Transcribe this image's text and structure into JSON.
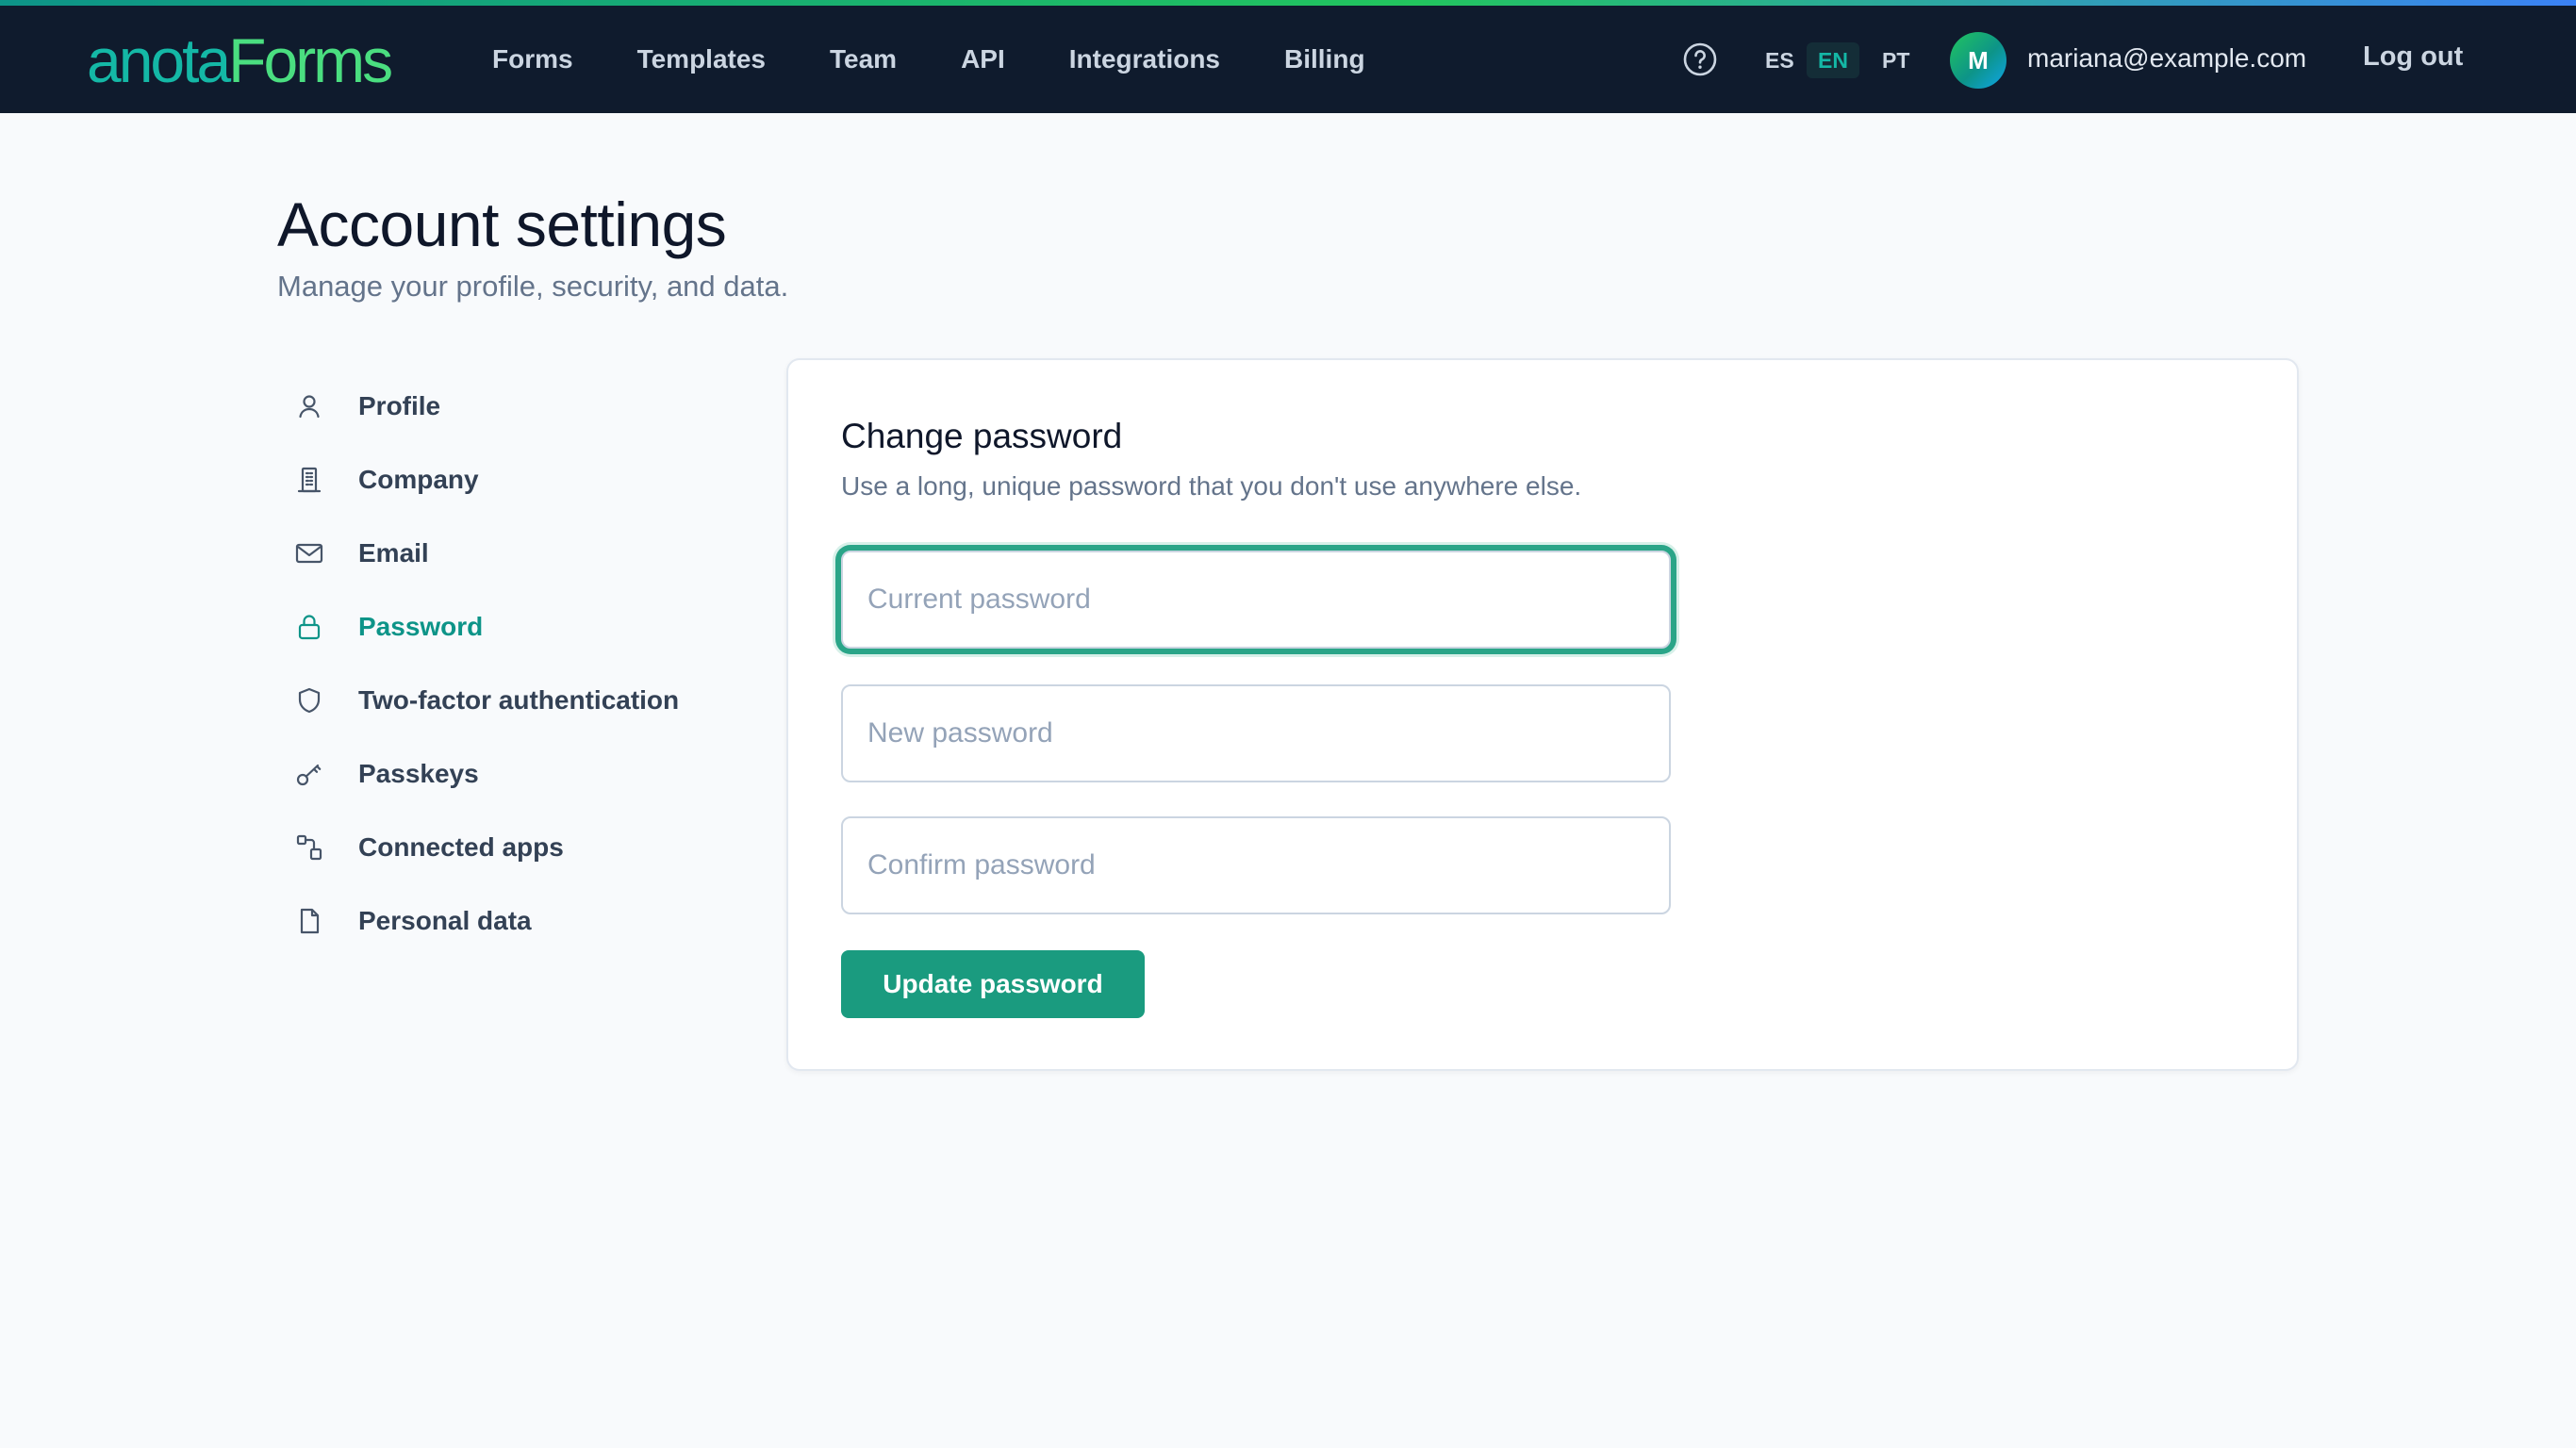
{
  "brand": {
    "part1": "anota",
    "part2": "Forms"
  },
  "nav": {
    "items": [
      {
        "label": "Forms"
      },
      {
        "label": "Templates"
      },
      {
        "label": "Team"
      },
      {
        "label": "API"
      },
      {
        "label": "Integrations"
      },
      {
        "label": "Billing"
      }
    ]
  },
  "header_tools": {
    "help_icon": "help-circle-icon",
    "languages": [
      {
        "code": "ES",
        "active": false
      },
      {
        "code": "EN",
        "active": true
      },
      {
        "code": "PT",
        "active": false
      }
    ],
    "avatar_initial": "M",
    "user_email": "mariana@example.com",
    "logout_label": "Log out"
  },
  "page": {
    "title": "Account settings",
    "subtitle": "Manage your profile, security, and data."
  },
  "sidebar": {
    "items": [
      {
        "label": "Profile",
        "icon": "user-icon",
        "active": false
      },
      {
        "label": "Company",
        "icon": "building-icon",
        "active": false
      },
      {
        "label": "Email",
        "icon": "mail-icon",
        "active": false
      },
      {
        "label": "Password",
        "icon": "lock-icon",
        "active": true
      },
      {
        "label": "Two-factor authentication",
        "icon": "shield-icon",
        "active": false
      },
      {
        "label": "Passkeys",
        "icon": "key-icon",
        "active": false
      },
      {
        "label": "Connected apps",
        "icon": "connected-apps-icon",
        "active": false
      },
      {
        "label": "Personal data",
        "icon": "document-icon",
        "active": false
      }
    ]
  },
  "password_card": {
    "title": "Change password",
    "description": "Use a long, unique password that you don't use anywhere else.",
    "current_password": {
      "placeholder": "Current password",
      "value": ""
    },
    "new_password": {
      "placeholder": "New password",
      "value": ""
    },
    "confirm_password": {
      "placeholder": "Confirm password",
      "value": ""
    },
    "submit_label": "Update password"
  },
  "colors": {
    "topbar_bg": "#0f1b2d",
    "accent": "#0d9488",
    "button_bg": "#1a9b7f",
    "page_bg": "#f8fafc"
  }
}
